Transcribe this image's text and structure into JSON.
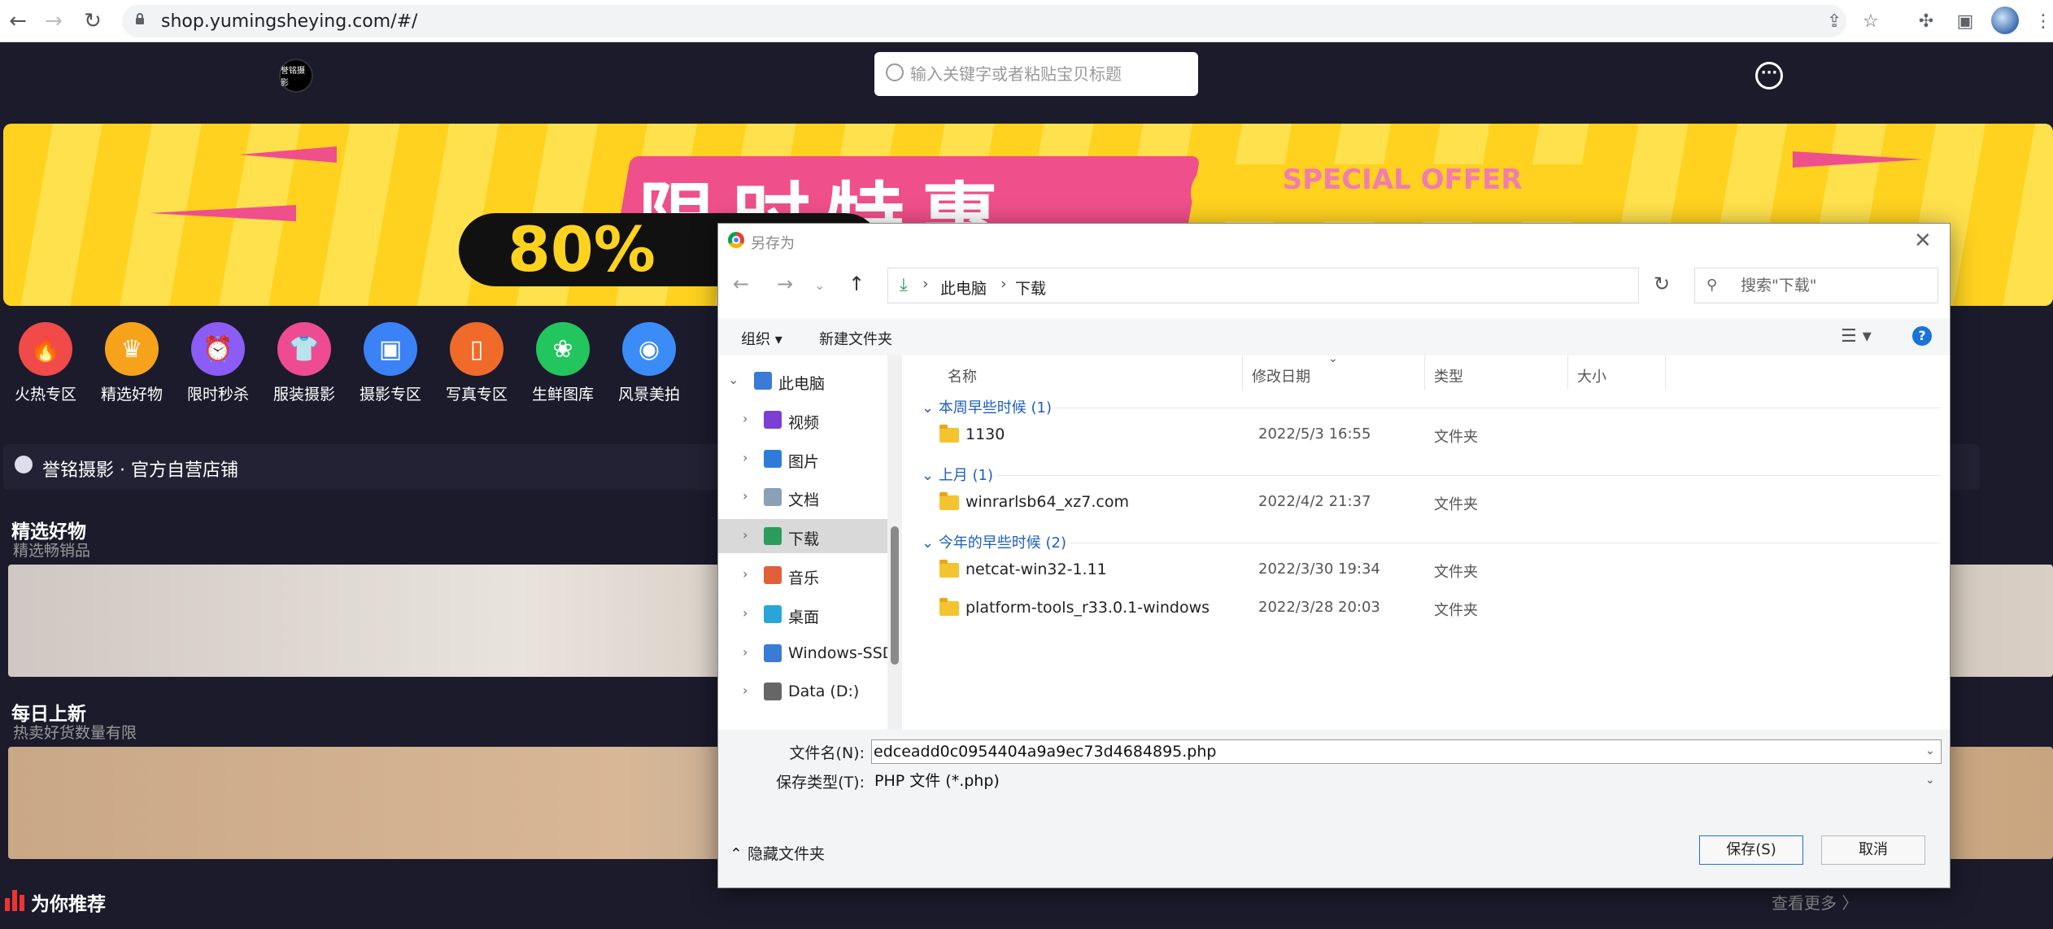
{
  "browser": {
    "back_icon": "arrow-left-icon",
    "forward_icon": "arrow-right-icon",
    "reload_icon": "reload-icon",
    "url": "shop.yumingsheying.com/#/"
  },
  "shop": {
    "logo_text": "誉铭摄影",
    "search_placeholder": "输入关键字或者粘贴宝贝标题",
    "banner": {
      "big_text": "限时特惠",
      "special": "SPECIAL OFFER",
      "percent": "80%"
    },
    "categories": [
      {
        "label": "火热专区",
        "color": "#f04b48",
        "icon": "🔥"
      },
      {
        "label": "精选好物",
        "color": "#f7a21b",
        "icon": "♛"
      },
      {
        "label": "限时秒杀",
        "color": "#8b5cf6",
        "icon": "⏰"
      },
      {
        "label": "服装摄影",
        "color": "#ef4b93",
        "icon": "👕"
      },
      {
        "label": "摄影专区",
        "color": "#3b82f6",
        "icon": "▣"
      },
      {
        "label": "写真专区",
        "color": "#f06a2a",
        "icon": "▯"
      },
      {
        "label": "生鲜图库",
        "color": "#22c55e",
        "icon": "❀"
      },
      {
        "label": "风景美拍",
        "color": "#3b8cf6",
        "icon": "◉"
      }
    ],
    "store_name": "誉铭摄影 · 官方自营店铺",
    "sections": [
      {
        "title": "精选好物",
        "subtitle": "精选畅销品"
      },
      {
        "title": "每日上新",
        "subtitle": "热卖好货数量有限"
      }
    ],
    "recommend_title": "为你推荐",
    "more_link": "查看更多 〉"
  },
  "dialog": {
    "title": "另存为",
    "breadcrumbs": [
      "此电脑",
      "下载"
    ],
    "search_placeholder": "搜索\"下载\"",
    "toolbar": {
      "organize": "组织 ▾",
      "new_folder": "新建文件夹"
    },
    "nav_items": [
      {
        "label": "此电脑",
        "icon": "computer-icon",
        "color": "#3a7bd5",
        "level": 0,
        "expanded": true
      },
      {
        "label": "视频",
        "icon": "video-icon",
        "color": "#7b3fd3",
        "level": 1
      },
      {
        "label": "图片",
        "icon": "pictures-icon",
        "color": "#2f7bd9",
        "level": 1
      },
      {
        "label": "文档",
        "icon": "documents-icon",
        "color": "#8aa0b8",
        "level": 1
      },
      {
        "label": "下载",
        "icon": "downloads-icon",
        "color": "#2a9d5c",
        "level": 1,
        "selected": true
      },
      {
        "label": "音乐",
        "icon": "music-icon",
        "color": "#e0603a",
        "level": 1
      },
      {
        "label": "桌面",
        "icon": "desktop-icon",
        "color": "#2aa5d9",
        "level": 1
      },
      {
        "label": "Windows-SSD",
        "icon": "windows-drive-icon",
        "color": "#3a7bd5",
        "level": 1
      },
      {
        "label": "Data (D:)",
        "icon": "drive-icon",
        "color": "#666666",
        "level": 1
      }
    ],
    "columns": {
      "name": "名称",
      "modified": "修改日期",
      "type": "类型",
      "size": "大小"
    },
    "groups": [
      {
        "label": "本周早些时候 (1)",
        "files": [
          {
            "name": "1130",
            "date": "2022/5/3 16:55",
            "type": "文件夹"
          }
        ]
      },
      {
        "label": "上月 (1)",
        "files": [
          {
            "name": "winrarlsb64_xz7.com",
            "date": "2022/4/2 21:37",
            "type": "文件夹"
          }
        ]
      },
      {
        "label": "今年的早些时候 (2)",
        "files": [
          {
            "name": "netcat-win32-1.11",
            "date": "2022/3/30 19:34",
            "type": "文件夹"
          },
          {
            "name": "platform-tools_r33.0.1-windows",
            "date": "2022/3/28 20:03",
            "type": "文件夹"
          }
        ]
      }
    ],
    "filename_label": "文件名(N):",
    "filename_value": "edceadd0c0954404a9a9ec73d4684895.php",
    "filetype_label": "保存类型(T):",
    "filetype_value": "PHP 文件 (*.php)",
    "hide_folders": "隐藏文件夹",
    "save_button": "保存(S)",
    "cancel_button": "取消"
  }
}
